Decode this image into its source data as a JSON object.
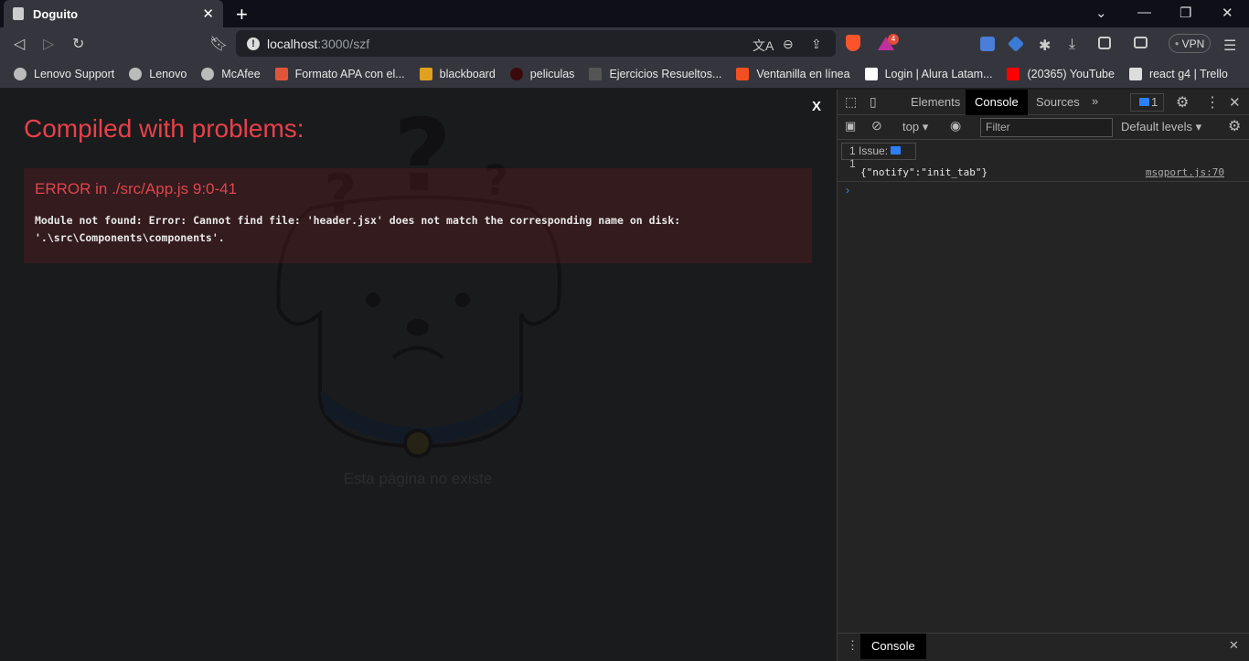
{
  "browser": {
    "tab_title": "Doguito",
    "url_host": "localhost",
    "url_rest": ":3000/szf",
    "shields_badge": "4",
    "vpn_label": "VPN",
    "bookmarks": [
      {
        "label": "Lenovo Support",
        "icon": "globe-icon",
        "color": "#bbbbbb"
      },
      {
        "label": "Lenovo",
        "icon": "globe-icon",
        "color": "#bbbbbb"
      },
      {
        "label": "McAfee",
        "icon": "globe-icon",
        "color": "#bbbbbb"
      },
      {
        "label": "Formato APA con el...",
        "icon": "graduation-cap-icon",
        "color": "#e0553a"
      },
      {
        "label": "blackboard",
        "icon": "pencil-icon",
        "color": "#e0a020"
      },
      {
        "label": "peliculas",
        "icon": "circle-icon",
        "color": "#3a0a0a"
      },
      {
        "label": "Ejercicios Resueltos...",
        "icon": "bird-icon",
        "color": "#555555"
      },
      {
        "label": "Ventanilla en línea",
        "icon": "windows-logo-icon",
        "color": "#f25022"
      },
      {
        "label": "Login | Alura Latam...",
        "icon": "alura-icon",
        "color": "#ffffff"
      },
      {
        "label": "(20365) YouTube",
        "icon": "youtube-icon",
        "color": "#ff0000"
      },
      {
        "label": "react g4 | Trello",
        "icon": "trello-icon",
        "color": "#dddddd"
      }
    ]
  },
  "page": {
    "not_exist_text": "Esta página no existe",
    "overlay": {
      "close_label": "X",
      "title": "Compiled with problems:",
      "error_heading": "ERROR in ./src/App.js 9:0-41",
      "error_message": "Module not found: Error: Cannot find file: 'header.jsx' does not match the corresponding name on disk:\n'.\\src\\Components\\components'."
    }
  },
  "devtools": {
    "tabs": [
      "Elements",
      "Console",
      "Sources"
    ],
    "active_tab": "Console",
    "issues_count": "1",
    "context": "top",
    "filter_placeholder": "Filter",
    "levels": "Default levels",
    "issues_label": "1 Issue:",
    "issues_badge": "1",
    "log": {
      "message": "{\"notify\":\"init_tab\"}",
      "source": "msgport.js:70"
    },
    "prompt": "›",
    "drawer_tab": "Console"
  },
  "colors": {
    "error": "#e8404a",
    "accent": "#2d7ff9"
  }
}
